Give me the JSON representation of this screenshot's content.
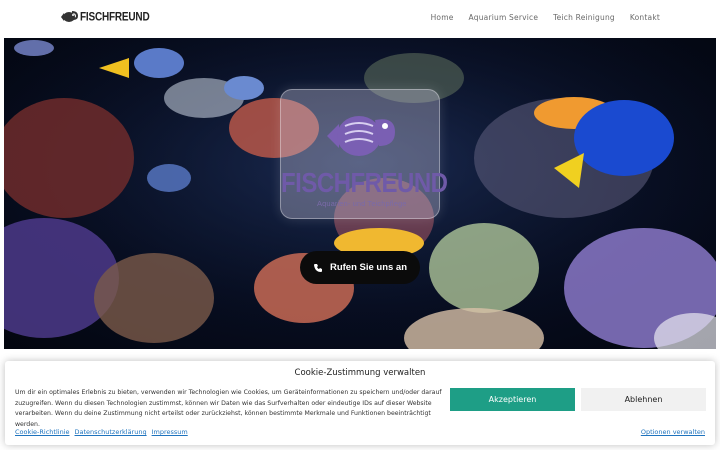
{
  "header": {
    "logo_text": "FISCHFREUND",
    "nav": [
      {
        "label": "Home"
      },
      {
        "label": "Aquarium Service"
      },
      {
        "label": "Teich Reinigung"
      },
      {
        "label": "Kontakt"
      }
    ]
  },
  "hero": {
    "brand_title": "FISCHFREUND",
    "brand_subtitle": "Aquarien- und Teichpflege",
    "call_button_label": "Rufen Sie uns an",
    "call_icon": "phone-icon",
    "colors": {
      "accent": "#6f5aa8",
      "button_bg": "#0b0b0b"
    }
  },
  "cookie": {
    "title": "Cookie-Zustimmung verwalten",
    "text": "Um dir ein optimales Erlebnis zu bieten, verwenden wir Technologien wie Cookies, um Geräteinformationen zu speichern und/oder darauf zuzugreifen. Wenn du diesen Technologien zustimmst, können wir Daten wie das Surfverhalten oder eindeutige IDs auf dieser Website verarbeiten. Wenn du deine Zustimmung nicht erteilst oder zurückziehst, können bestimmte Merkmale und Funktionen beeinträchtigt werden.",
    "accept_label": "Akzeptieren",
    "deny_label": "Ablehnen",
    "links": [
      {
        "label": "Cookie-Richtlinie"
      },
      {
        "label": "Datenschutzerklärung"
      },
      {
        "label": "Impressum"
      }
    ],
    "options_label": "Optionen verwalten",
    "colors": {
      "accept": "#1e9e86",
      "deny": "#f1f1f1",
      "link": "#1e73be"
    }
  }
}
